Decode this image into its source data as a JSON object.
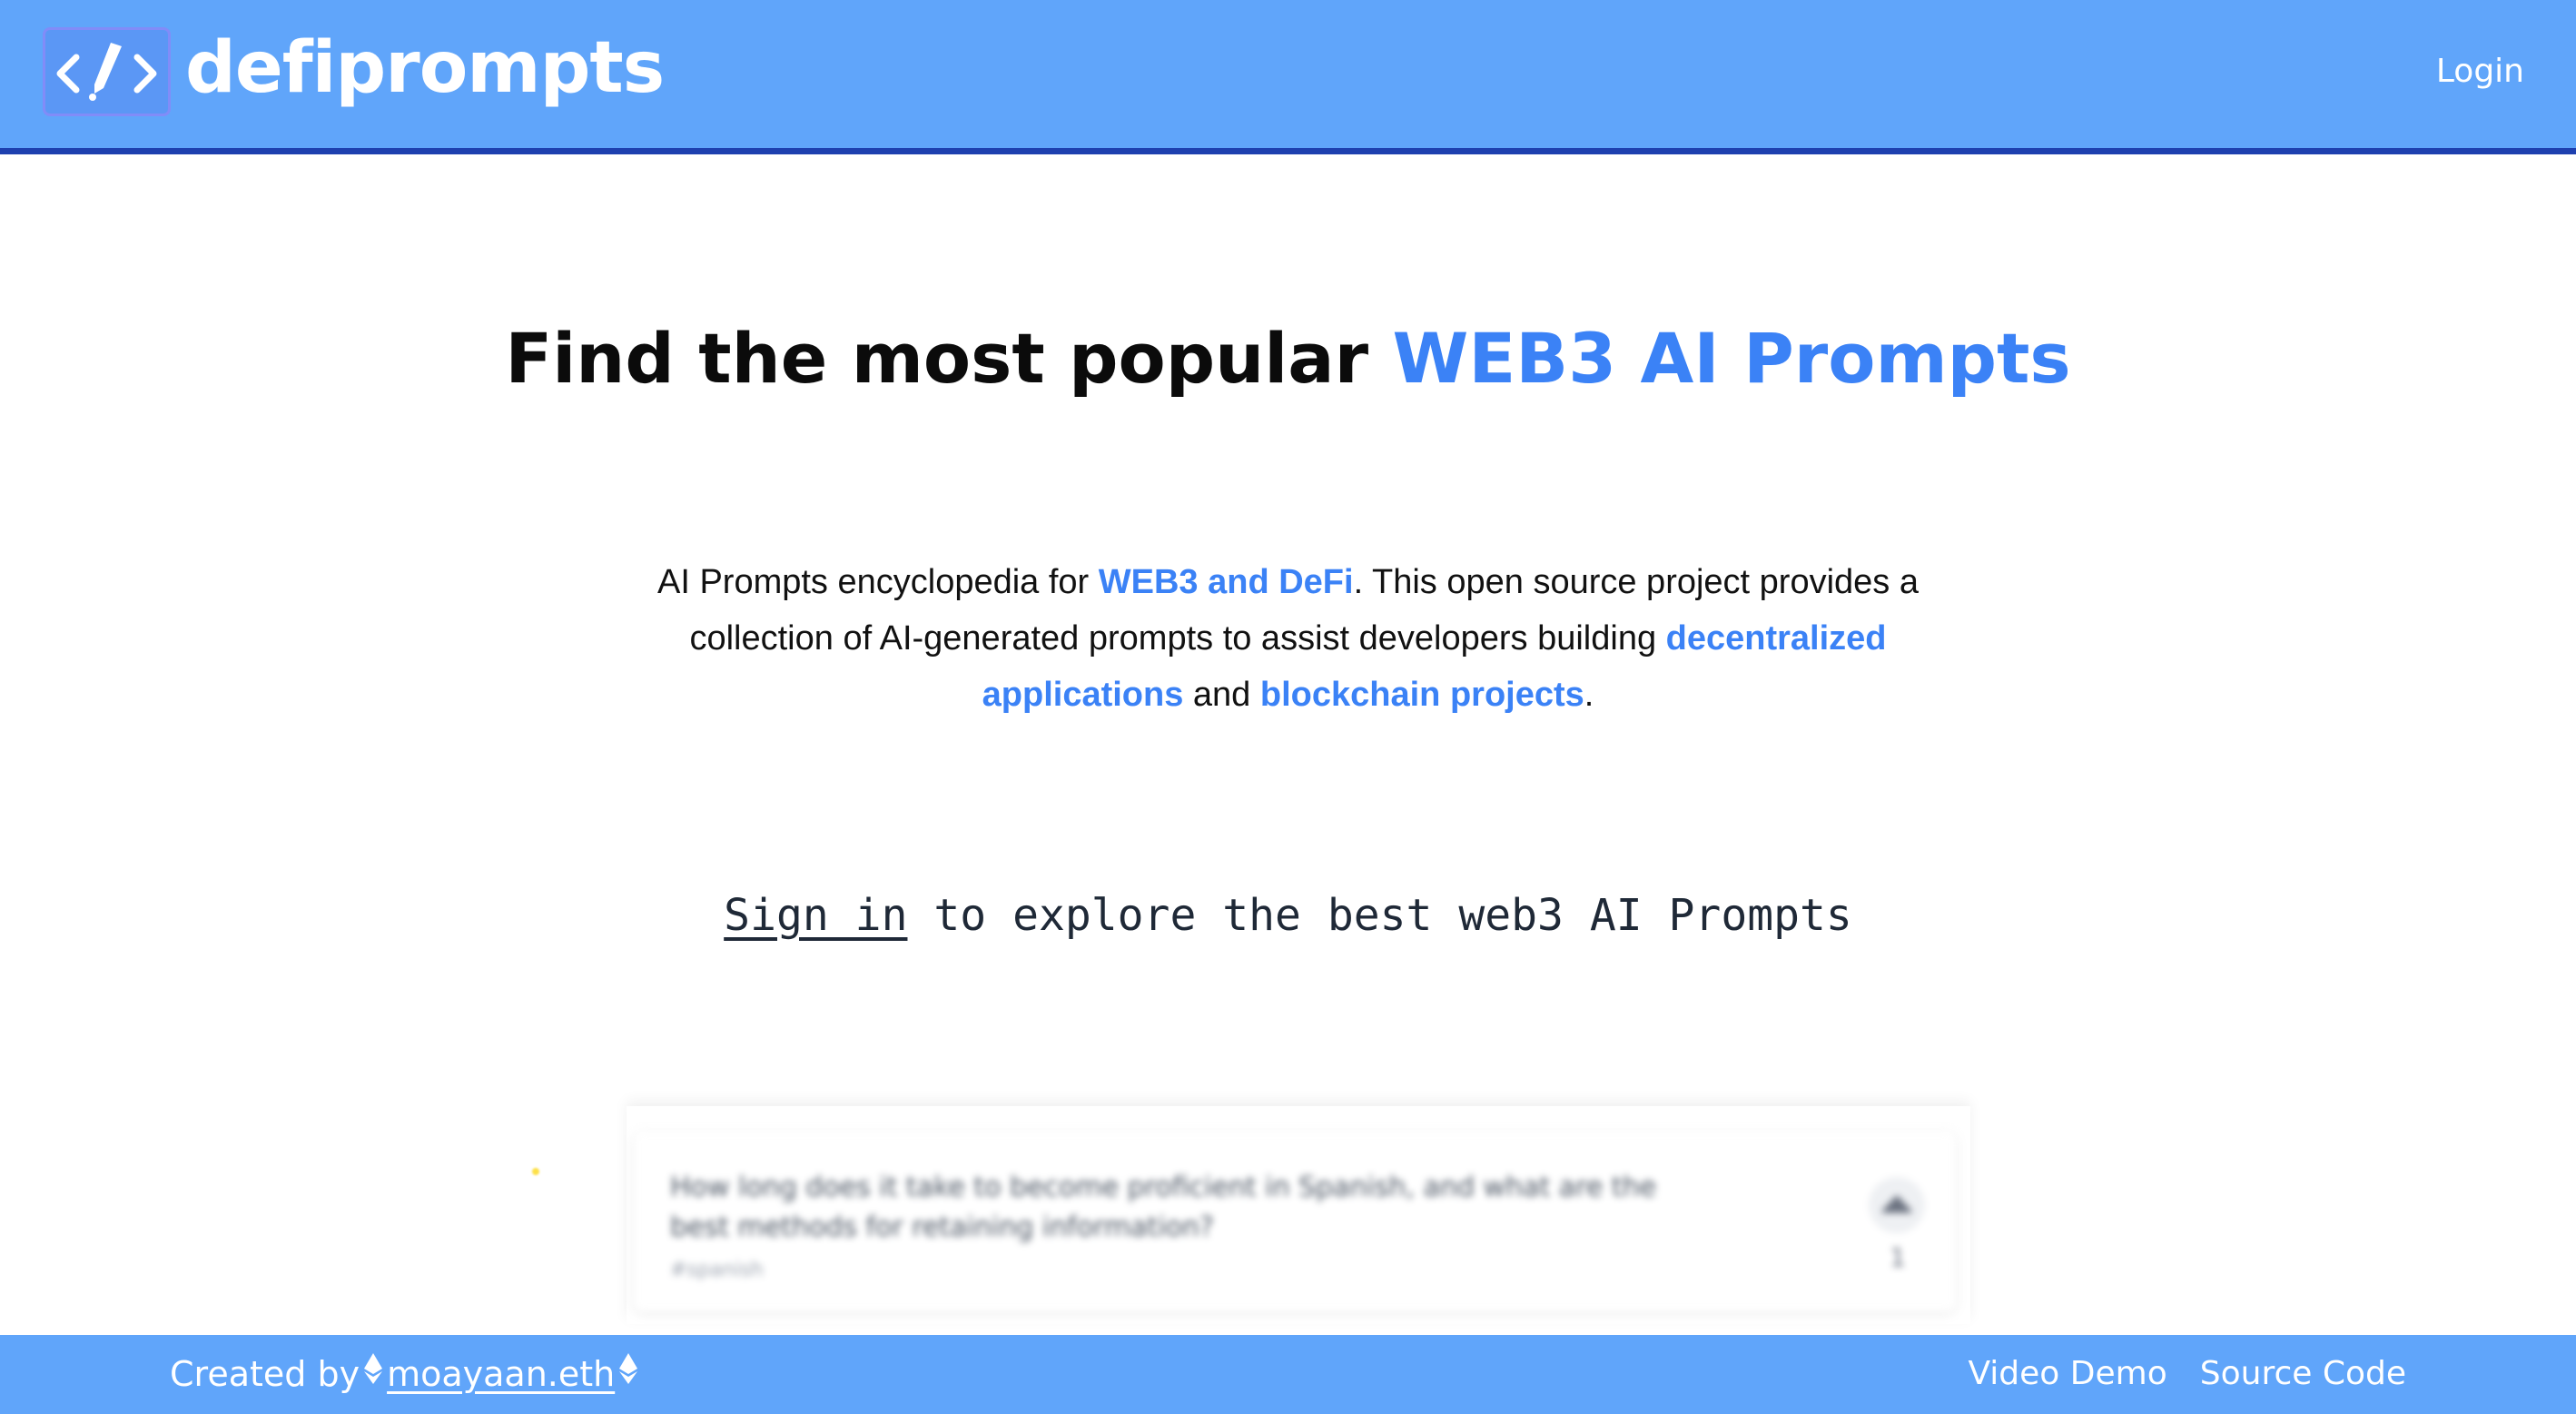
{
  "header": {
    "brand": "defiprompts",
    "login_label": "Login",
    "logo_icon": "code-pen-icon"
  },
  "hero": {
    "title_prefix": "Find the most popular ",
    "title_accent": "WEB3 AI Prompts"
  },
  "intro": {
    "part1": "AI Prompts encyclopedia for ",
    "hl1": "WEB3 and DeFi",
    "part2": ". This open source project provides a collection of AI-generated prompts to assist developers building ",
    "hl2": "decentralized applications",
    "part3": " and ",
    "hl3": "blockchain projects",
    "part4": "."
  },
  "signin": {
    "link_label": "Sign in",
    "rest": " to explore the best web3 AI Prompts"
  },
  "preview_card": {
    "question": "How long does it take to become proficient in Spanish, and what are the best methods for retaining information?",
    "tag": "#spanish",
    "votes": "1"
  },
  "footer": {
    "created_by": "Created by",
    "author": "moayaan.eth",
    "links": [
      "Video Demo",
      "Source Code"
    ]
  },
  "colors": {
    "header_bg": "#60a5fa",
    "header_border": "#1e40af",
    "accent": "#3b82f6"
  }
}
